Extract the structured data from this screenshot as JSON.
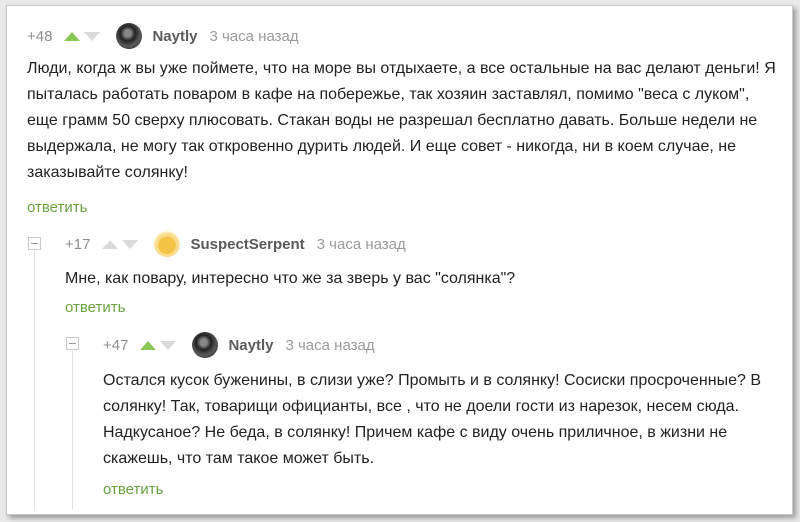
{
  "comments": [
    {
      "rating": "+48",
      "author": "Naytly",
      "time": "3 часа назад",
      "text": "Люди, когда ж вы уже поймете, что на море вы отдыхаете, а все остальные на вас делают деньги! Я пыталась работать поваром в кафе на побережье, так хозяин заставлял, помимо \"веса с луком\", еще грамм 50 сверху плюсовать. Стакан воды не разрешал бесплатно давать. Больше недели не выдержала, не могу так откровенно дурить людей. И еще совет - никогда, ни в коем случае, не заказывайте солянку!",
      "reply": "ответить",
      "upvoted": true
    },
    {
      "rating": "+17",
      "author": "SuspectSerpent",
      "time": "3 часа назад",
      "text": "Мне, как повару, интересно что же за зверь у вас \"солянка\"?",
      "reply": "ответить",
      "upvoted": false
    },
    {
      "rating": "+47",
      "author": "Naytly",
      "time": "3 часа назад",
      "text": "Остался кусок буженины, в слизи уже? Промыть и в солянку! Сосиски просроченные? В солянку! Так, товарищи официанты, все , что не доели гости из нарезок, несем сюда. Надкусаное? Не беда, в солянку! Причем кафе с виду очень приличное, в жизни не скажешь, что там такое может быть.",
      "reply": "ответить",
      "upvoted": true
    }
  ],
  "colors": {
    "upvote_active": "#8ac858",
    "reply_link": "#6aa23f",
    "author": "#5a5a5a",
    "meta": "#9b9b9b"
  },
  "icons": {
    "upvote": "triangle-up-icon",
    "downvote": "triangle-down-icon",
    "collapse": "minus-square-icon"
  }
}
